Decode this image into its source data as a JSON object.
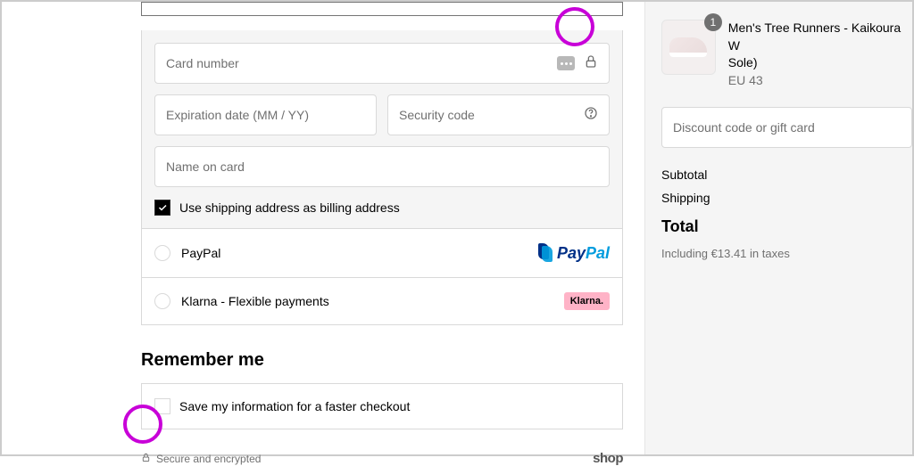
{
  "payment": {
    "card": {
      "number_placeholder": "Card number",
      "expiry_placeholder": "Expiration date (MM / YY)",
      "cvc_placeholder": "Security code",
      "name_placeholder": "Name on card",
      "billing_checkbox_label": "Use shipping address as billing address"
    },
    "options": {
      "paypal": {
        "label": "PayPal",
        "brand_pay": "Pay",
        "brand_pal": "Pal"
      },
      "klarna": {
        "label": "Klarna - Flexible payments",
        "brand": "Klarna."
      }
    }
  },
  "remember": {
    "heading": "Remember me",
    "checkbox_label": "Save my information for a faster checkout"
  },
  "footer": {
    "secure_text": "Secure and encrypted",
    "shop_logo": "shop"
  },
  "cart": {
    "item": {
      "qty": "1",
      "title": "Men's Tree Runners - Kaikoura W",
      "subtitle": "Sole)",
      "variant": "EU 43"
    },
    "discount_placeholder": "Discount code or gift card",
    "summary": {
      "subtotal_label": "Subtotal",
      "shipping_label": "Shipping",
      "total_label": "Total",
      "taxes_text": "Including €13.41 in taxes"
    }
  }
}
